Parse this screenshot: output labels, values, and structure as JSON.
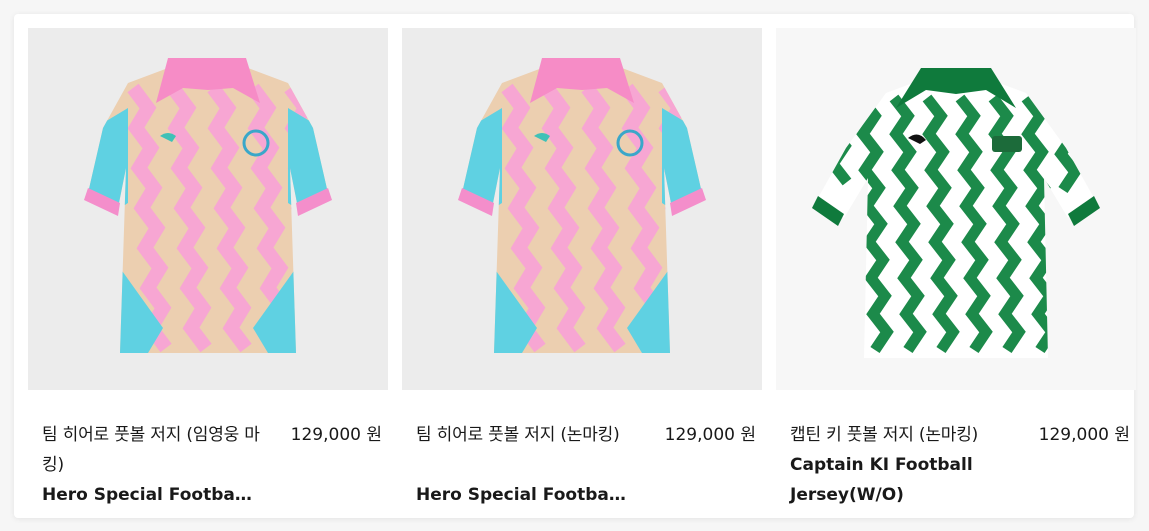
{
  "products": [
    {
      "name_ko": "팀 히어로 풋볼 저지 (임영웅 마킹)",
      "price": "129,000 원",
      "name_en": "Hero Special Footba…",
      "colors": {
        "body": "#eccfb0",
        "stripe": "#f7a6d3",
        "sleeve": "#5fd1e2",
        "collar": "#f68cc6",
        "cuff": "#f48ecb",
        "background": "#ececec"
      },
      "image_icon": "football-jersey-icon"
    },
    {
      "name_ko": "팀 히어로 풋볼 저지 (논마킹)",
      "price": "129,000 원",
      "name_en": "Hero Special Footba…",
      "colors": {
        "body": "#eccfb0",
        "stripe": "#f7a6d3",
        "sleeve": "#5fd1e2",
        "collar": "#f68cc6",
        "cuff": "#f48ecb",
        "background": "#ececec"
      },
      "image_icon": "football-jersey-icon"
    },
    {
      "name_ko": "캡틴 키 풋볼 저지 (논마킹)",
      "price": "129,000 원",
      "name_en": "Captain KI Football Jersey(W/O)",
      "colors": {
        "body": "#ffffff",
        "stripe": "#1c8a4a",
        "sleeve": "#ffffff",
        "collar": "#0f7a3c",
        "cuff": "#0f7a3c",
        "background": "#f7f7f7"
      },
      "image_icon": "football-jersey-icon"
    }
  ]
}
